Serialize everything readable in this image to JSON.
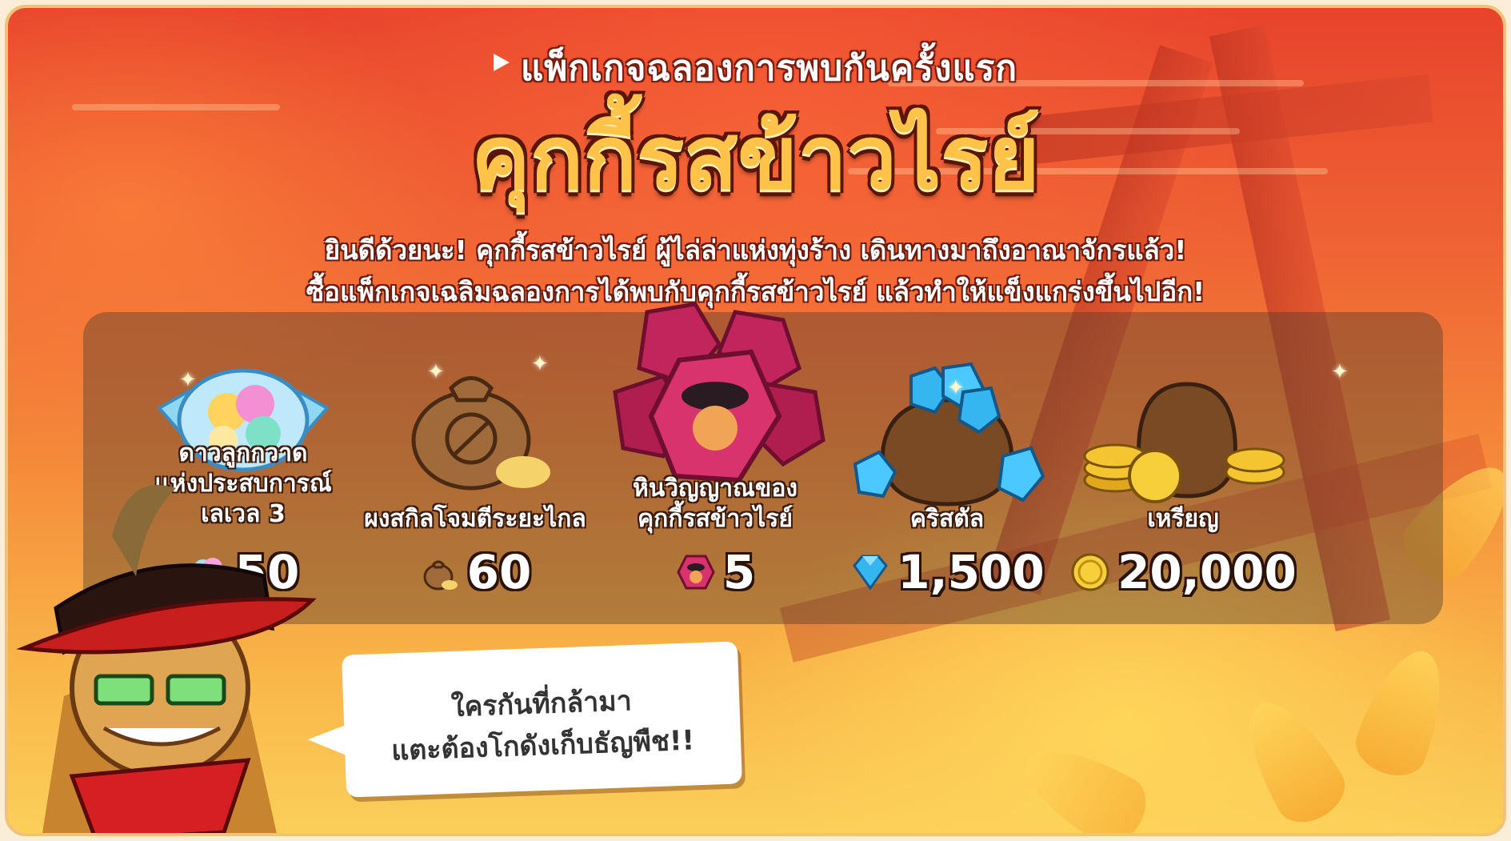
{
  "banner": {
    "tagline": "แพ็กเกจฉลองการพบกันครั้งแรก",
    "title": "คุกกี้รสข้าวไรย์",
    "description_lines": [
      "ยินดีด้วยนะ! คุกกี้รสข้าวไรย์ ผู้ไล่ล่าแห่งทุ่งร้าง เดินทางมาถึงอาณาจักรแล้ว!",
      "ซื้อแพ็กเกจเฉลิมฉลองการได้พบกับคุกกี้รสข้าวไรย์ แล้วทำให้แข็งแกร่งขึ้นไปอีก!"
    ]
  },
  "rewards": [
    {
      "name_lines": [
        "ดาวลูกกวาด",
        "แห่งประสบการณ์",
        "เลเวล 3"
      ],
      "amount": "50",
      "icon": "exp-star-candy-icon"
    },
    {
      "name_lines": [
        "ผงสกิลโจมตีระยะไกล"
      ],
      "amount": "60",
      "icon": "skill-powder-bag-icon"
    },
    {
      "name_lines": [
        "หินวิญญาณของ",
        "คุกกี้รสข้าวไรย์"
      ],
      "amount": "5",
      "icon": "soulstone-icon"
    },
    {
      "name_lines": [
        "คริสตัล"
      ],
      "amount": "1,500",
      "icon": "crystal-icon"
    },
    {
      "name_lines": [
        "เหรียญ"
      ],
      "amount": "20,000",
      "icon": "coin-icon"
    }
  ],
  "speech_bubble": {
    "lines": [
      "ใครกันที่กล้ามา",
      "แตะต้องโกดังเก็บธัญพืช!!"
    ]
  },
  "colors": {
    "background_top": "#e8432c",
    "background_bottom": "#fbcf5a",
    "title_fill": "#ffc34a",
    "outline": "#5a1608",
    "panel": "rgba(80,60,45,.42)"
  }
}
